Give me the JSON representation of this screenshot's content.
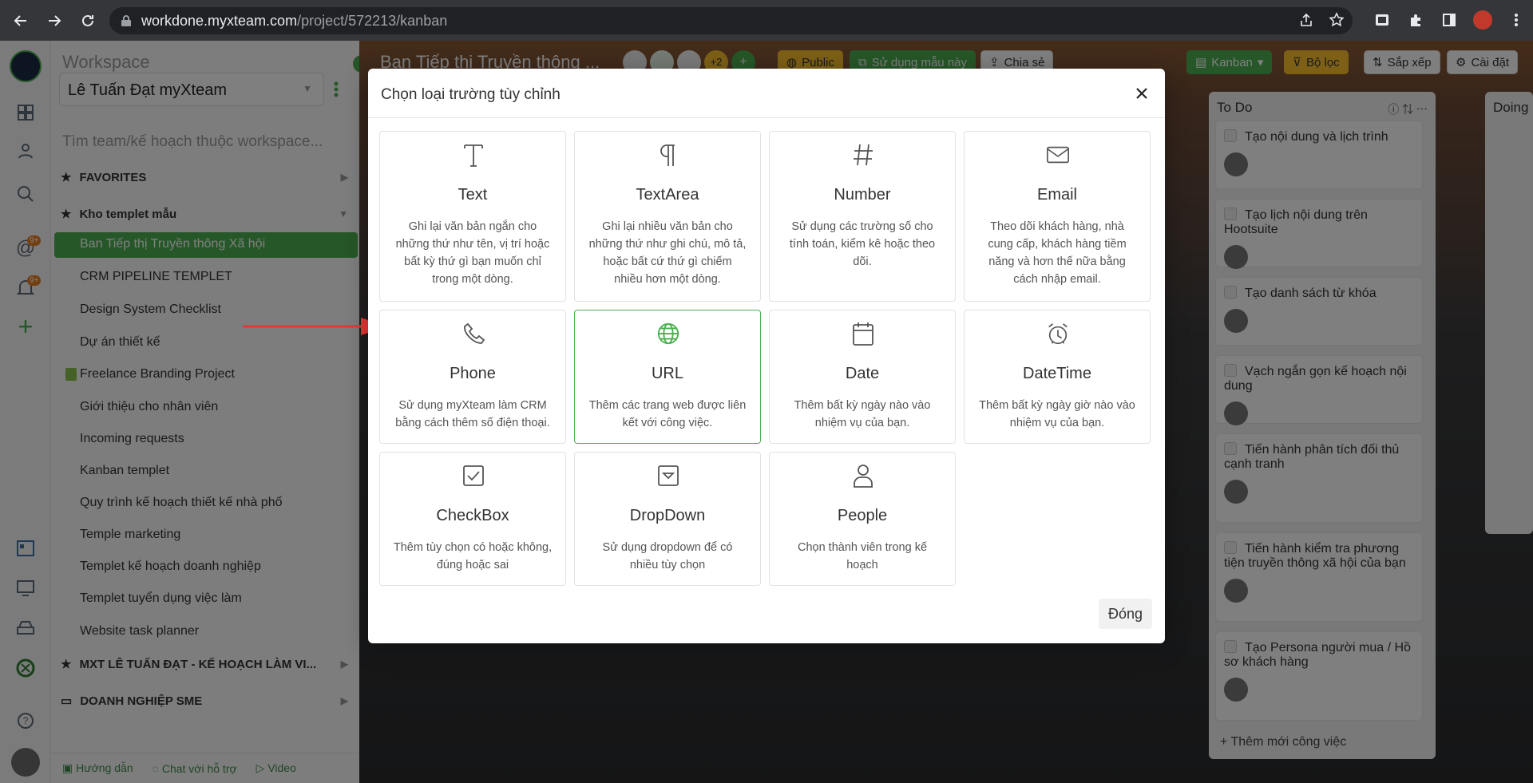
{
  "browser": {
    "url_host": "workdone.myxteam.com",
    "url_path": "/project/572213/kanban",
    "icons": [
      "back-icon",
      "forward-icon",
      "reload-icon",
      "lock-icon",
      "share-icon",
      "star-icon",
      "extension-icon",
      "puzzle-icon",
      "sidebar-icon",
      "profile-avatar",
      "menu-icon"
    ]
  },
  "sidebar": {
    "workspace_label": "Workspace",
    "workspace_select": "Lê Tuấn Đạt myXteam",
    "search_placeholder": "Tìm team/kế hoạch thuộc workspace...",
    "groups": [
      {
        "label": "FAVORITES"
      },
      {
        "label": "Kho templet mẫu"
      },
      {
        "label": "MXT LÊ TUẤN ĐẠT - KẾ HOẠCH LÀM VI..."
      },
      {
        "label": "DOANH NGHIỆP SME"
      }
    ],
    "items": [
      {
        "label": "Ban Tiếp thị Truyền thông Xã hội",
        "active": true
      },
      {
        "label": "CRM PIPELINE TEMPLET"
      },
      {
        "label": "Design System Checklist"
      },
      {
        "label": "Dự án thiết kế"
      },
      {
        "label": "Freelance Branding Project"
      },
      {
        "label": "Giới thiệu cho nhân viên"
      },
      {
        "label": "Incoming requests"
      },
      {
        "label": "Kanban templet"
      },
      {
        "label": "Quy trình kế hoạch thiết kế nhà phố"
      },
      {
        "label": "Temple marketing"
      },
      {
        "label": "Templet kế hoạch doanh nghiệp"
      },
      {
        "label": "Templet tuyển dụng việc làm"
      },
      {
        "label": "Website task planner"
      }
    ],
    "footer": {
      "guide": "Hướng dẫn",
      "chat": "Chat với hỗ trợ",
      "video": "Video"
    },
    "badge_counts": [
      "9+",
      "9+"
    ]
  },
  "board": {
    "title": "Ban Tiếp thị Truyền thông ...",
    "member_extra": "+2",
    "public_label": "Public",
    "use_template_label": "Sử dụng mẫu này",
    "share_label": "Chia sẻ",
    "view_label": "Kanban",
    "filter_label": "Bộ lọc",
    "sort_label": "Sắp xếp",
    "settings_label": "Cài đặt",
    "columns": [
      {
        "title": "To Do",
        "cards": [
          "Tạo nội dung và lịch trình",
          "Tạo lịch nội dung trên Hootsuite",
          "Tạo danh sách từ khóa",
          "Vạch ngắn gọn kế hoạch nội dung",
          "Tiến hành phân tích đối thủ cạnh tranh",
          "Tiến hành kiểm tra phương tiện truyền thông xã hội của bạn",
          "Tạo Persona người mua / Hồ sơ khách hàng"
        ],
        "add_label": "Thêm mới công việc"
      },
      {
        "title": "Doing"
      }
    ]
  },
  "modal": {
    "title": "Chọn loại trường tùy chỉnh",
    "close_label": "Đóng",
    "field_types": [
      {
        "name": "Text",
        "icon": "text-icon",
        "desc": "Ghi lại văn bản ngắn cho những thứ như tên, vị trí hoặc bất kỳ thứ gì bạn muốn chỉ trong một dòng."
      },
      {
        "name": "TextArea",
        "icon": "paragraph-icon",
        "desc": "Ghi lại nhiều văn bản cho những thứ như ghi chú, mô tả, hoặc bất cứ thứ gì chiếm nhiều hơn một dòng."
      },
      {
        "name": "Number",
        "icon": "hash-icon",
        "desc": "Sử dụng các trường số cho tính toán, kiểm kê hoặc theo dõi."
      },
      {
        "name": "Email",
        "icon": "envelope-icon",
        "desc": "Theo dõi khách hàng, nhà cung cấp, khách hàng tiềm năng và hơn thế nữa bằng cách nhập email."
      },
      {
        "name": "Phone",
        "icon": "phone-icon",
        "desc": "Sử dụng myXteam làm CRM bằng cách thêm số điện thoại."
      },
      {
        "name": "URL",
        "icon": "globe-icon",
        "desc": "Thêm các trang web được liên kết với công việc.",
        "selected": true
      },
      {
        "name": "Date",
        "icon": "calendar-icon",
        "desc": "Thêm bất kỳ ngày nào vào nhiệm vụ của bạn."
      },
      {
        "name": "DateTime",
        "icon": "alarm-clock-icon",
        "desc": "Thêm bất kỳ ngày giờ nào vào nhiệm vụ của bạn."
      },
      {
        "name": "CheckBox",
        "icon": "checkbox-icon",
        "desc": "Thêm tùy chọn có hoặc không, đúng hoặc sai"
      },
      {
        "name": "DropDown",
        "icon": "dropdown-icon",
        "desc": "Sử dụng dropdown để có nhiều tùy chọn"
      },
      {
        "name": "People",
        "icon": "person-icon",
        "desc": "Chọn thành viên trong kế hoạch"
      }
    ]
  },
  "colors": {
    "accent": "#4caf50",
    "annotation_arrow": "#e53935",
    "overlay": "rgba(0,0,0,0.5)"
  }
}
